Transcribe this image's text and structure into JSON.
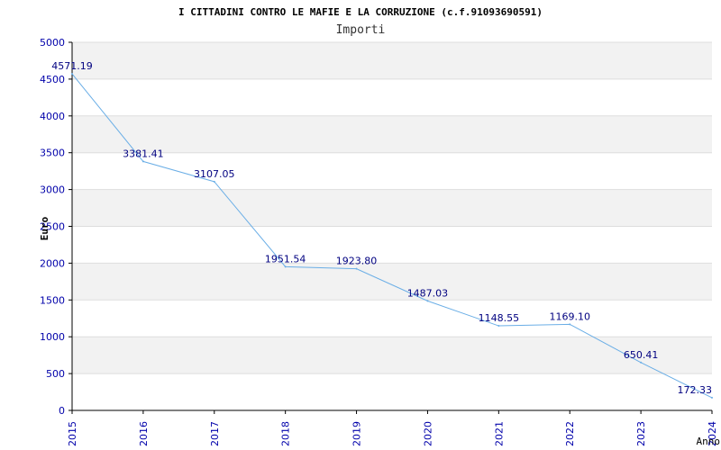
{
  "chart_data": {
    "type": "line",
    "title": "I CITTADINI CONTRO LE MAFIE E LA CORRUZIONE (c.f.91093690591)",
    "subtitle": "Importi",
    "xlabel": "Anno",
    "ylabel": "Euro",
    "x": [
      "2015",
      "2016",
      "2017",
      "2018",
      "2019",
      "2020",
      "2021",
      "2022",
      "2023",
      "2024"
    ],
    "series": [
      {
        "values": [
          4571.19,
          3381.41,
          3107.05,
          1951.54,
          1923.8,
          1487.03,
          1148.55,
          1169.1,
          650.41,
          172.33
        ],
        "labels": [
          "4571.19",
          "3381.41",
          "3107.05",
          "1951.54",
          "1923.80",
          "1487.03",
          "1148.55",
          "1169.10",
          "650.41",
          "172.33"
        ]
      }
    ],
    "ylim": [
      0,
      5000
    ],
    "yticks": [
      "0",
      "500",
      "1000",
      "1500",
      "2000",
      "2500",
      "3000",
      "3500",
      "4000",
      "4500",
      "5000"
    ],
    "grid": true,
    "colors": {
      "line": "#6aaee6",
      "band": "#f2f2f2",
      "gridline": "#dddddd",
      "tick_text": "#0000aa",
      "label_text": "#000080",
      "title_text": "#000000",
      "subtitle_text": "#333333"
    }
  }
}
